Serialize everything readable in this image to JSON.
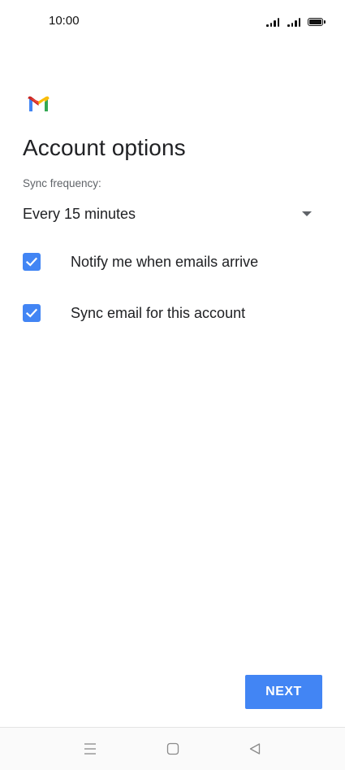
{
  "status_bar": {
    "time": "10:00"
  },
  "app": {
    "logo_icon": "gmail-logo-icon",
    "title": "Account options"
  },
  "sync": {
    "label": "Sync frequency:",
    "selected_value": "Every 15 minutes"
  },
  "options": [
    {
      "label": "Notify me when emails arrive",
      "checked": true
    },
    {
      "label": "Sync email for this account",
      "checked": true
    }
  ],
  "actions": {
    "next_label": "NEXT"
  },
  "colors": {
    "accent": "#4285f4",
    "text_primary": "#202124",
    "text_secondary": "#5f6368"
  },
  "nav_bar": {
    "icons": [
      "menu-icon",
      "home-icon",
      "back-icon"
    ]
  }
}
